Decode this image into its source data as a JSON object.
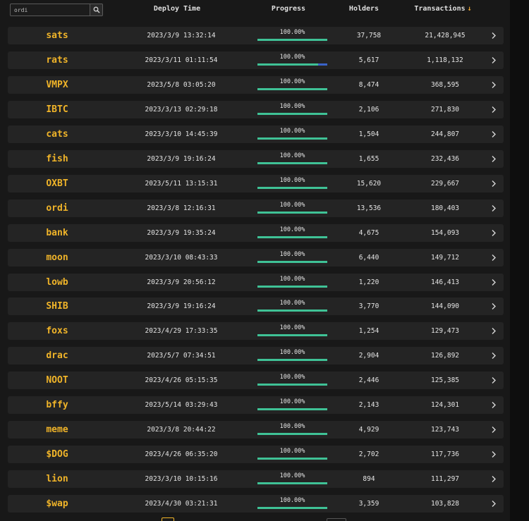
{
  "search": {
    "value": "ordi",
    "icon": "search-icon"
  },
  "columns": {
    "deploy_time": "Deploy Time",
    "progress": "Progress",
    "holders": "Holders",
    "transactions": "Transactions",
    "sort_arrow": "↓"
  },
  "colors": {
    "ticker": "#f0b429",
    "progress_fill": "#3fc296",
    "progress_track": "#3a63c9",
    "row_bg": "#242424"
  },
  "rows": [
    {
      "tick": "sats",
      "deploy": "2023/3/9 13:32:14",
      "progress_label": "100.00%",
      "progress": 1.0,
      "holders": "37,758",
      "transactions": "21,428,945"
    },
    {
      "tick": "rats",
      "deploy": "2023/3/11 01:11:54",
      "progress_label": "100.00%",
      "progress": 0.87,
      "holders": "5,617",
      "transactions": "1,118,132"
    },
    {
      "tick": "VMPX",
      "deploy": "2023/5/8 03:05:20",
      "progress_label": "100.00%",
      "progress": 1.0,
      "holders": "8,474",
      "transactions": "368,595"
    },
    {
      "tick": "IBTC",
      "deploy": "2023/3/13 02:29:18",
      "progress_label": "100.00%",
      "progress": 1.0,
      "holders": "2,106",
      "transactions": "271,830"
    },
    {
      "tick": "cats",
      "deploy": "2023/3/10 14:45:39",
      "progress_label": "100.00%",
      "progress": 1.0,
      "holders": "1,504",
      "transactions": "244,807"
    },
    {
      "tick": "fish",
      "deploy": "2023/3/9 19:16:24",
      "progress_label": "100.00%",
      "progress": 1.0,
      "holders": "1,655",
      "transactions": "232,436"
    },
    {
      "tick": "OXBT",
      "deploy": "2023/5/11 13:15:31",
      "progress_label": "100.00%",
      "progress": 1.0,
      "holders": "15,620",
      "transactions": "229,667"
    },
    {
      "tick": "ordi",
      "deploy": "2023/3/8 12:16:31",
      "progress_label": "100.00%",
      "progress": 1.0,
      "holders": "13,536",
      "transactions": "180,403"
    },
    {
      "tick": "bank",
      "deploy": "2023/3/9 19:35:24",
      "progress_label": "100.00%",
      "progress": 1.0,
      "holders": "4,675",
      "transactions": "154,093"
    },
    {
      "tick": "moon",
      "deploy": "2023/3/10 08:43:33",
      "progress_label": "100.00%",
      "progress": 1.0,
      "holders": "6,440",
      "transactions": "149,712"
    },
    {
      "tick": "lowb",
      "deploy": "2023/3/9 20:56:12",
      "progress_label": "100.00%",
      "progress": 1.0,
      "holders": "1,220",
      "transactions": "146,413"
    },
    {
      "tick": "SHIB",
      "deploy": "2023/3/9 19:16:24",
      "progress_label": "100.00%",
      "progress": 1.0,
      "holders": "3,770",
      "transactions": "144,090"
    },
    {
      "tick": "foxs",
      "deploy": "2023/4/29 17:33:35",
      "progress_label": "100.00%",
      "progress": 1.0,
      "holders": "1,254",
      "transactions": "129,473"
    },
    {
      "tick": "drac",
      "deploy": "2023/5/7 07:34:51",
      "progress_label": "100.00%",
      "progress": 1.0,
      "holders": "2,904",
      "transactions": "126,892"
    },
    {
      "tick": "NOOT",
      "deploy": "2023/4/26 05:15:35",
      "progress_label": "100.00%",
      "progress": 1.0,
      "holders": "2,446",
      "transactions": "125,385"
    },
    {
      "tick": "bffy",
      "deploy": "2023/5/14 03:29:43",
      "progress_label": "100.00%",
      "progress": 1.0,
      "holders": "2,143",
      "transactions": "124,301"
    },
    {
      "tick": "meme",
      "deploy": "2023/3/8 20:44:22",
      "progress_label": "100.00%",
      "progress": 1.0,
      "holders": "4,929",
      "transactions": "123,743"
    },
    {
      "tick": "$DOG",
      "deploy": "2023/4/26 06:35:20",
      "progress_label": "100.00%",
      "progress": 1.0,
      "holders": "2,702",
      "transactions": "117,736"
    },
    {
      "tick": "lion",
      "deploy": "2023/3/10 10:15:16",
      "progress_label": "100.00%",
      "progress": 1.0,
      "holders": "894",
      "transactions": "111,297"
    },
    {
      "tick": "$wap",
      "deploy": "2023/4/30 03:21:31",
      "progress_label": "100.00%",
      "progress": 1.0,
      "holders": "3,359",
      "transactions": "103,828"
    }
  ]
}
